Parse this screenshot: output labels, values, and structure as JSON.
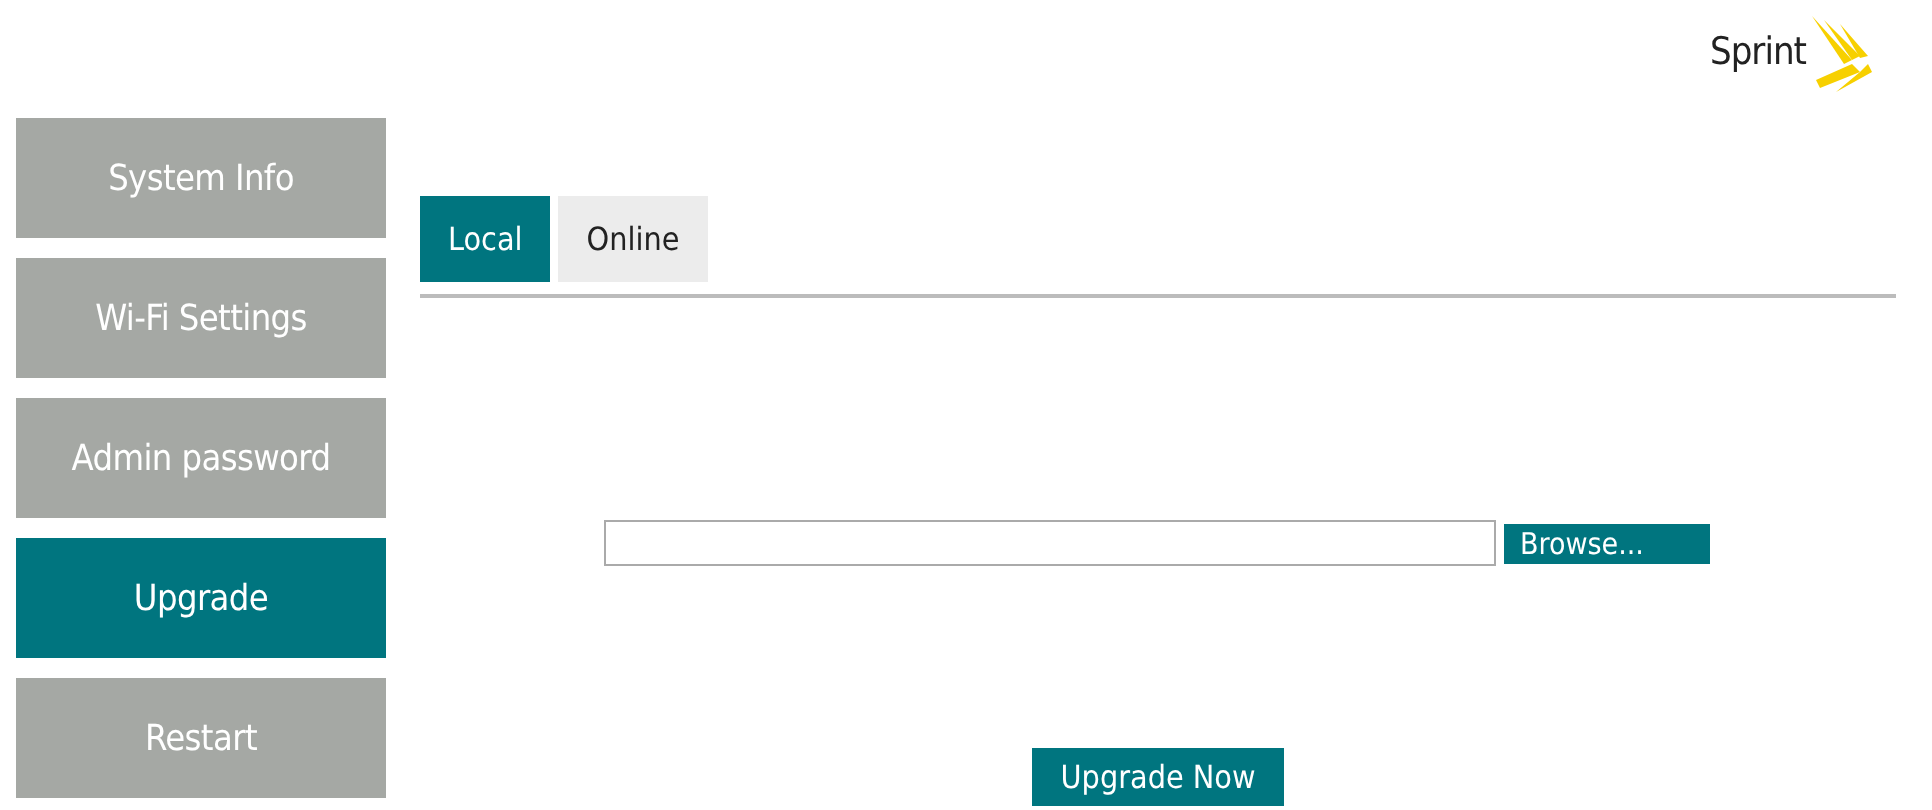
{
  "logo": {
    "text": "Sprint"
  },
  "sidebar": {
    "items": [
      {
        "label": "System Info",
        "selected": false
      },
      {
        "label": "Wi-Fi Settings",
        "selected": false
      },
      {
        "label": "Admin password",
        "selected": false
      },
      {
        "label": "Upgrade",
        "selected": true
      },
      {
        "label": "Restart",
        "selected": false
      }
    ]
  },
  "tabs": [
    {
      "label": "Local",
      "selected": true
    },
    {
      "label": "Online",
      "selected": false
    }
  ],
  "file_field": {
    "button": "Browse..."
  },
  "submit": {
    "label": "Upgrade Now"
  }
}
